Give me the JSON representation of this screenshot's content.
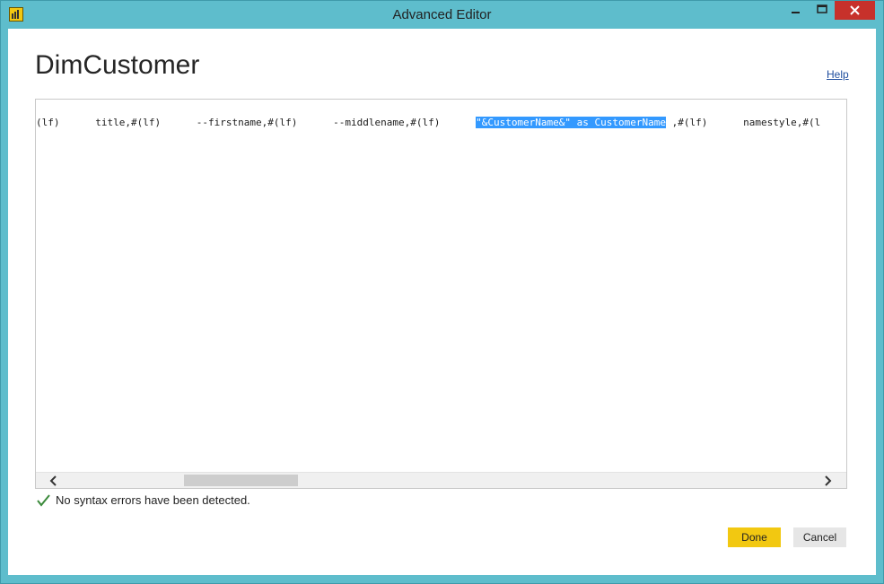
{
  "window": {
    "title": "Advanced Editor",
    "app_icon": "power-bi-icon",
    "controls": [
      "minimize-icon",
      "maximize-icon",
      "close-icon"
    ],
    "accent_color": "#5ebdcc",
    "close_color": "#c7312b"
  },
  "editor": {
    "query_name": "DimCustomer",
    "help_label": "Help",
    "code": {
      "before": "(lf)      title,#(lf)      --firstname,#(lf)      --middlename,#(lf)      ",
      "selected": "\"&CustomerName&\" as CustomerName",
      "after": " ,#(lf)      namestyle,#(l"
    },
    "selection_color": "#3399ff"
  },
  "status": {
    "icon": "checkmark-icon",
    "text": "No syntax errors have been detected."
  },
  "buttons": {
    "done": "Done",
    "cancel": "Cancel",
    "done_color": "#f2c811"
  }
}
